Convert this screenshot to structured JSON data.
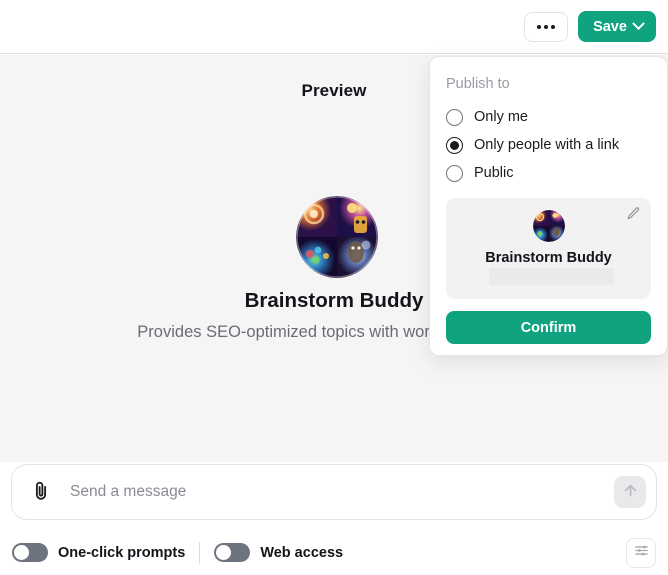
{
  "header": {
    "more_button_label": "",
    "more_icon": "ellipsis-horizontal-icon",
    "save_label": "Save",
    "save_chevron_icon": "chevron-down-icon",
    "accent_color": "#10a37f"
  },
  "preview": {
    "title": "Preview",
    "avatar_icon": "bot-avatar-image",
    "bot_name": "Brainstorm Buddy",
    "description": "Provides SEO-optimized topics with word count limits."
  },
  "composer": {
    "attach_icon": "paperclip-icon",
    "placeholder": "Send a message",
    "value": "",
    "send_icon": "arrow-up-icon"
  },
  "bottom_toolbar": {
    "toggles": [
      {
        "label": "One-click prompts",
        "state": "off",
        "icon": "toggle-switch-icon"
      },
      {
        "label": "Web access",
        "state": "off",
        "icon": "toggle-switch-icon"
      }
    ],
    "settings_icon": "sliders-icon",
    "toggle_track_color": "#6e7380"
  },
  "publish_dropdown": {
    "title": "Publish to",
    "options": [
      {
        "label": "Only me",
        "selected": false
      },
      {
        "label": "Only people with a link",
        "selected": true
      },
      {
        "label": "Public",
        "selected": false
      }
    ],
    "card": {
      "avatar_icon": "bot-avatar-image",
      "name": "Brainstorm Buddy",
      "redacted_text": "",
      "edit_icon": "pencil-icon"
    },
    "confirm_label": "Confirm"
  }
}
